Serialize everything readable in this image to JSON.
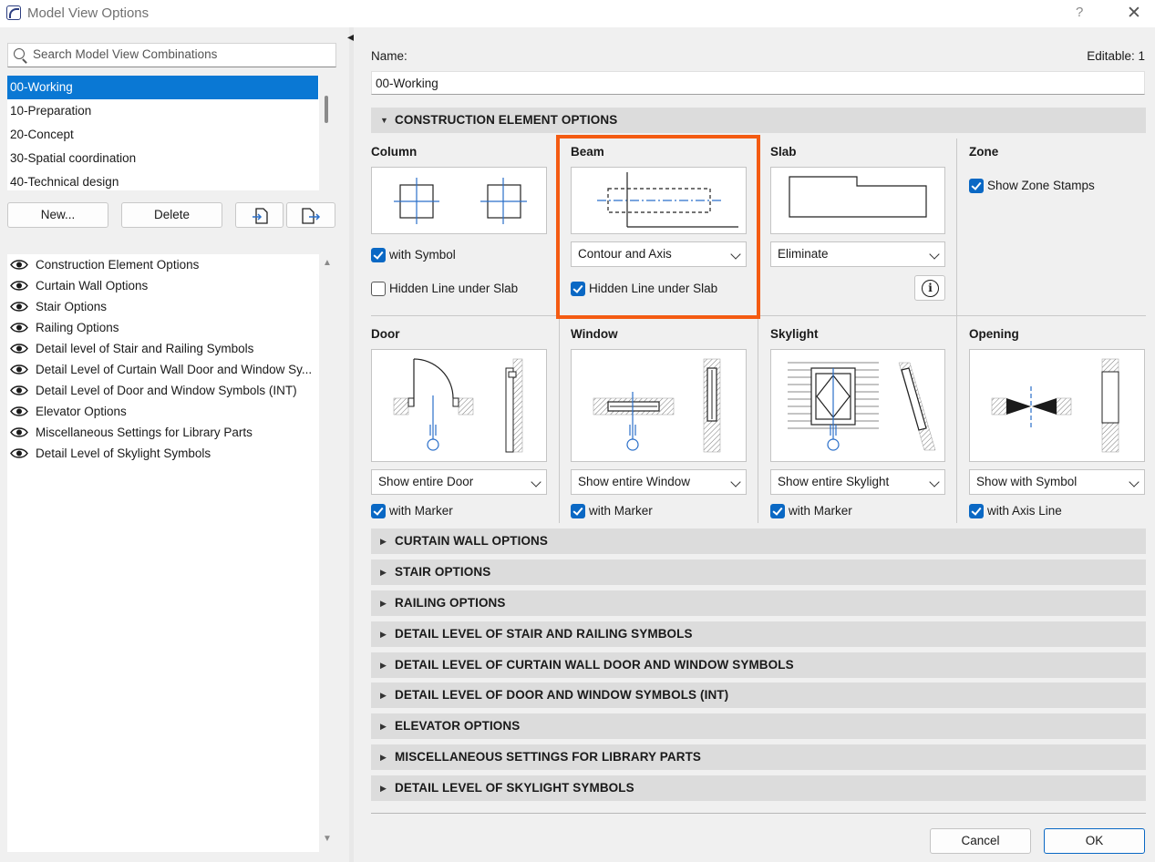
{
  "window": {
    "title": "Model View Options",
    "help": "?",
    "close": "✕"
  },
  "left": {
    "search_placeholder": "Search Model View Combinations",
    "combinations": [
      "00-Working",
      "10-Preparation",
      "20-Concept",
      "30-Spatial coordination",
      "40-Technical design"
    ],
    "selected_index": 0,
    "buttons": {
      "new": "New...",
      "delete": "Delete"
    },
    "options": [
      "Construction Element Options",
      "Curtain Wall Options",
      "Stair Options",
      "Railing Options",
      "Detail level of Stair and Railing Symbols",
      "Detail Level of Curtain Wall Door and Window Sy...",
      "Detail Level of Door and Window Symbols (INT)",
      "Elevator Options",
      "Miscellaneous Settings for Library Parts",
      "Detail Level of Skylight Symbols"
    ]
  },
  "right": {
    "name_label": "Name:",
    "editable_label": "Editable: 1",
    "name_value": "00-Working",
    "construction_header": "CONSTRUCTION ELEMENT OPTIONS",
    "column": {
      "title": "Column",
      "with_symbol": "with Symbol",
      "with_symbol_checked": true,
      "hidden_line": "Hidden Line under Slab",
      "hidden_line_checked": false
    },
    "beam": {
      "title": "Beam",
      "display": "Contour and Axis",
      "hidden_line": "Hidden Line under Slab",
      "hidden_line_checked": true
    },
    "slab": {
      "title": "Slab",
      "display": "Eliminate"
    },
    "zone": {
      "title": "Zone",
      "show_stamps": "Show Zone Stamps",
      "show_stamps_checked": true
    },
    "door": {
      "title": "Door",
      "display": "Show entire Door",
      "marker": "with Marker",
      "marker_checked": true
    },
    "window_el": {
      "title": "Window",
      "display": "Show entire Window",
      "marker": "with Marker",
      "marker_checked": true
    },
    "skylight": {
      "title": "Skylight",
      "display": "Show entire Skylight",
      "marker": "with Marker",
      "marker_checked": true
    },
    "opening": {
      "title": "Opening",
      "display": "Show with Symbol",
      "axis_line": "with Axis Line",
      "axis_line_checked": true
    },
    "collapsed_sections": [
      "CURTAIN WALL OPTIONS",
      "STAIR OPTIONS",
      "RAILING OPTIONS",
      "DETAIL LEVEL OF STAIR AND RAILING SYMBOLS",
      "DETAIL LEVEL OF CURTAIN WALL DOOR AND WINDOW SYMBOLS",
      "DETAIL LEVEL OF DOOR AND WINDOW SYMBOLS (INT)",
      "ELEVATOR OPTIONS",
      "MISCELLANEOUS SETTINGS FOR LIBRARY PARTS",
      "DETAIL LEVEL OF SKYLIGHT SYMBOLS"
    ],
    "cancel": "Cancel",
    "ok": "OK"
  },
  "colors": {
    "accent": "#0a78d4",
    "checkbox": "#0a68c4",
    "highlight": "#f45b12",
    "symbol_blue": "#2a6fc9"
  },
  "icons": {
    "search": "search-icon",
    "eye": "eye-icon",
    "import": "import-icon",
    "export": "export-icon",
    "info": "info-icon",
    "app": "archicad-icon"
  }
}
